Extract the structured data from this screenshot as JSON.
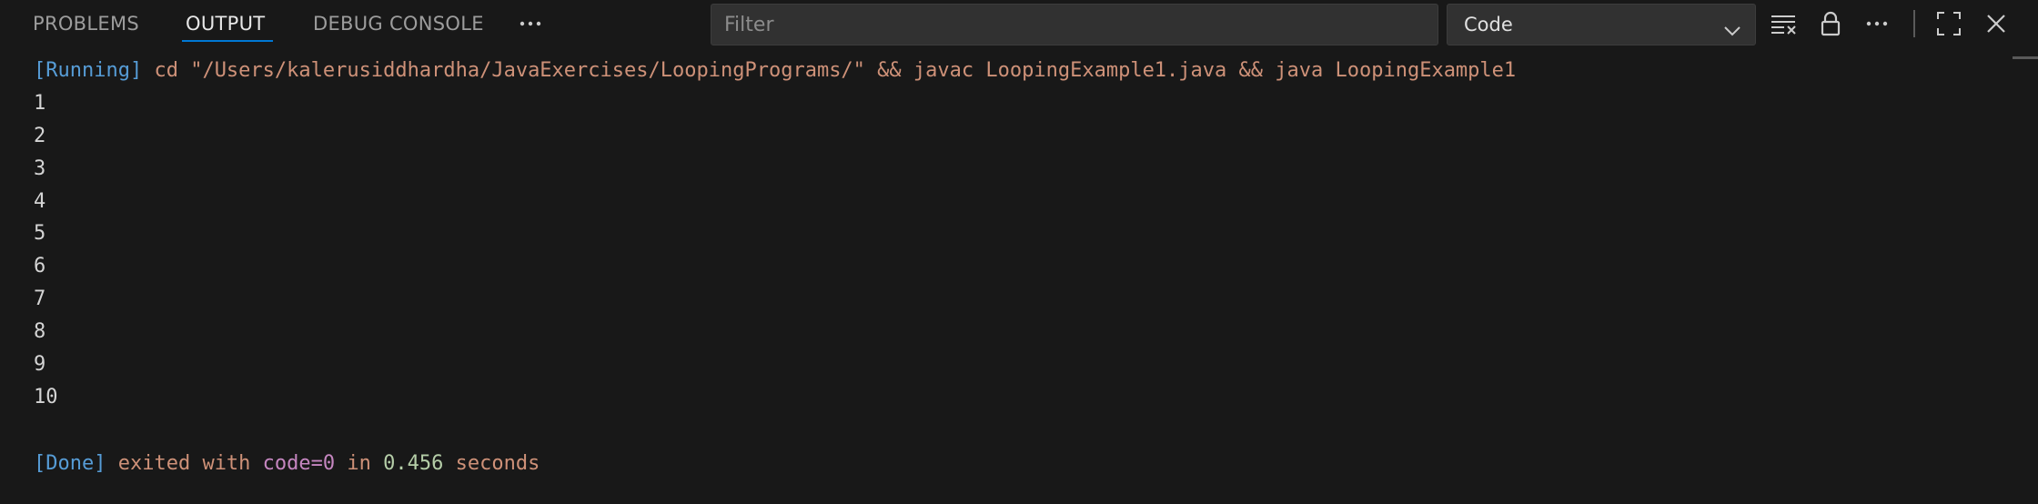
{
  "tabs": [
    {
      "label": "PROBLEMS"
    },
    {
      "label": "OUTPUT"
    },
    {
      "label": "DEBUG CONSOLE"
    }
  ],
  "active_tab": "OUTPUT",
  "filter": {
    "placeholder": "Filter",
    "value": ""
  },
  "channel_select": {
    "value": "Code"
  },
  "output": {
    "running": {
      "tag": "[Running]",
      "command": " cd \"/Users/kalerusiddhardha/JavaExercises/LoopingPrograms/\" && javac LoopingExample1.java && java LoopingExample1"
    },
    "lines": [
      "1",
      "2",
      "3",
      "4",
      "5",
      "6",
      "7",
      "8",
      "9",
      "10"
    ],
    "done": {
      "tag": "[Done]",
      "text1": " exited with ",
      "code_label": "code=0",
      "text2": " in ",
      "duration": "0.456",
      "text3": " seconds"
    }
  },
  "icons": {
    "more_tabs": "ellipsis-icon",
    "clear_output": "clear-all-icon",
    "lock": "lock-icon",
    "more_actions": "ellipsis-icon",
    "maximize": "maximize-icon",
    "close": "close-icon",
    "select_chevron": "chevron-down-icon"
  },
  "colors": {
    "background": "#181818",
    "active_tab_underline": "#0078d4",
    "tag": "#569cd6",
    "command": "#ce9178",
    "keyword": "#c586c0",
    "number": "#b5cea8"
  }
}
